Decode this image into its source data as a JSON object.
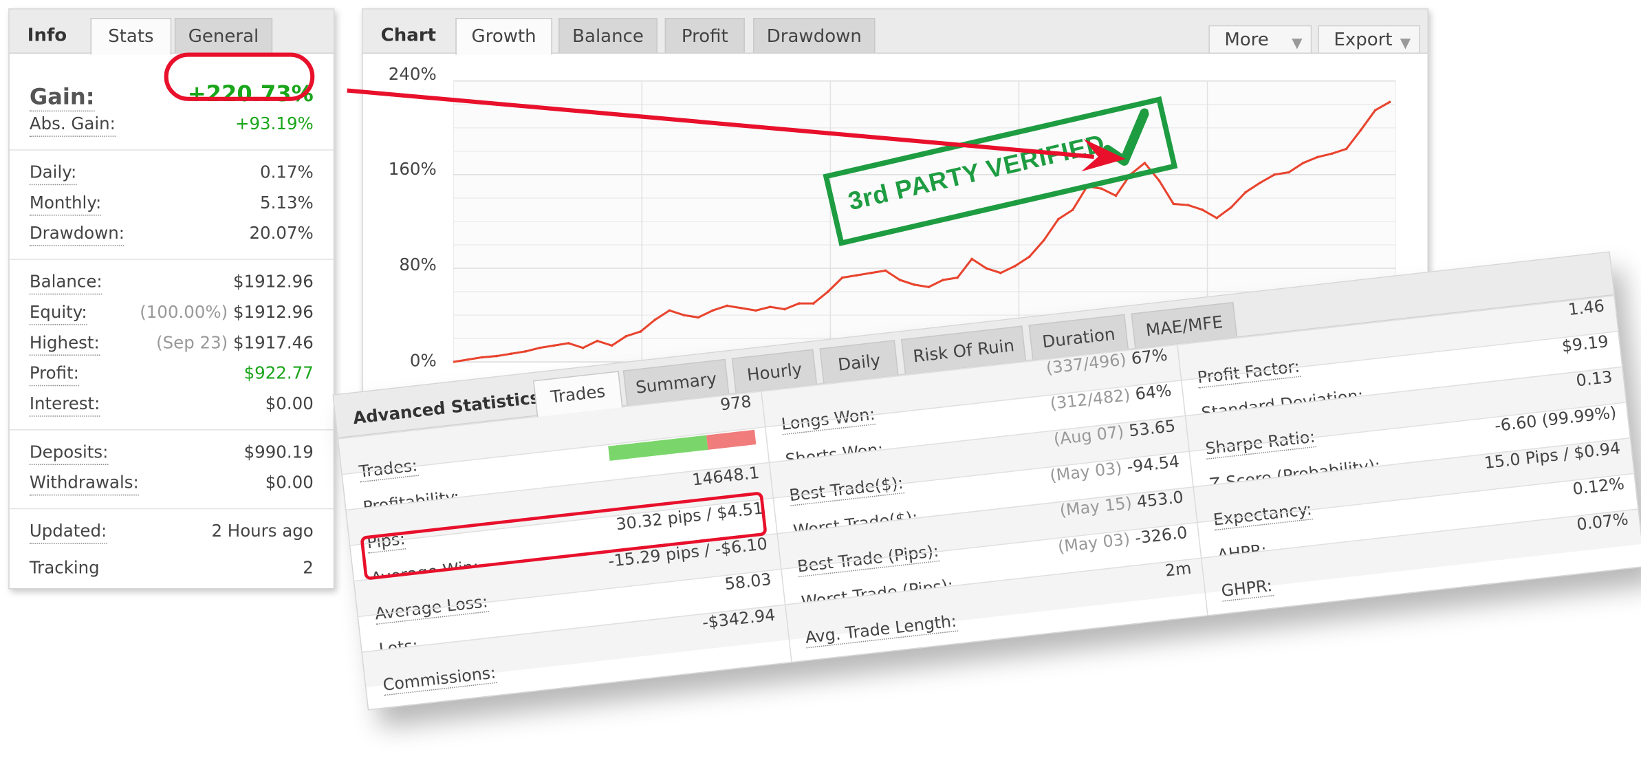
{
  "info_panel": {
    "tabs": [
      {
        "label": "Info"
      },
      {
        "label": "Stats"
      },
      {
        "label": "General"
      }
    ],
    "gain": {
      "label": "Gain:",
      "value": "+220.73%"
    },
    "groups": [
      [
        {
          "label": "Abs. Gain:",
          "value": "+93.19%",
          "green": true
        }
      ],
      [
        {
          "label": "Daily:",
          "value": "0.17%"
        },
        {
          "label": "Monthly:",
          "value": "5.13%"
        },
        {
          "label": "Drawdown:",
          "value": "20.07%"
        }
      ],
      [
        {
          "label": "Balance:",
          "value": "$1912.96"
        },
        {
          "label": "Equity:",
          "note": "(100.00%)",
          "value": "$1912.96"
        },
        {
          "label": "Highest:",
          "note": "(Sep 23)",
          "value": "$1917.46"
        },
        {
          "label": "Profit:",
          "value": "$922.77",
          "green": true
        },
        {
          "label": "Interest:",
          "value": "$0.00"
        }
      ],
      [
        {
          "label": "Deposits:",
          "value": "$990.19"
        },
        {
          "label": "Withdrawals:",
          "value": "$0.00"
        }
      ],
      [
        {
          "label": "Updated:",
          "value": "2 Hours ago"
        },
        {
          "label": "Tracking",
          "value": "2",
          "plain": true
        }
      ]
    ]
  },
  "chart_panel": {
    "tabs": [
      {
        "label": "Chart"
      },
      {
        "label": "Growth"
      },
      {
        "label": "Balance"
      },
      {
        "label": "Profit"
      },
      {
        "label": "Drawdown"
      }
    ],
    "more_label": "More",
    "export_label": "Export",
    "stamp_text": "3rd PARTY VERIFIED"
  },
  "chart_data": {
    "type": "line",
    "title": "",
    "xlabel": "",
    "ylabel": "",
    "y_ticks": [
      "240%",
      "160%",
      "80%",
      "0%"
    ],
    "ylim": [
      0,
      240
    ],
    "grid": true,
    "color": "#e8442e",
    "series": [
      {
        "values": [
          0,
          2,
          4,
          5,
          7,
          9,
          12,
          14,
          16,
          12,
          18,
          14,
          22,
          26,
          36,
          44,
          40,
          38,
          44,
          48,
          46,
          44,
          47,
          45,
          50,
          50,
          60,
          72,
          74,
          76,
          78,
          70,
          66,
          64,
          70,
          72,
          88,
          80,
          76,
          82,
          90,
          104,
          122,
          130,
          150,
          148,
          142,
          160,
          170,
          155,
          135,
          134,
          130,
          123,
          132,
          145,
          153,
          160,
          162,
          170,
          175,
          178,
          182,
          198,
          215,
          222
        ]
      }
    ]
  },
  "advanced": {
    "title": "Advanced Statistics",
    "tabs": [
      {
        "label": "Trades"
      },
      {
        "label": "Summary"
      },
      {
        "label": "Hourly"
      },
      {
        "label": "Daily"
      },
      {
        "label": "Risk Of Ruin"
      },
      {
        "label": "Duration"
      },
      {
        "label": "MAE/MFE"
      }
    ],
    "col1": [
      {
        "label": "Trades:",
        "value": "978"
      },
      {
        "label": "Profitability:",
        "value": "",
        "bar": true
      },
      {
        "label": "Pips:",
        "value": "14648.1"
      },
      {
        "label": "Average Win:",
        "value": "30.32 pips / $4.51"
      },
      {
        "label": "Average Loss:",
        "value": "-15.29 pips / -$6.10"
      },
      {
        "label": "Lots:",
        "value": "58.03"
      },
      {
        "label": "Commissions:",
        "value": "-$342.94"
      }
    ],
    "profitability": {
      "win_fraction": 0.67
    },
    "col2": [
      {
        "label": "Longs Won:",
        "note": "(337/496)",
        "value": "67%"
      },
      {
        "label": "Shorts Won:",
        "note": "(312/482)",
        "value": "64%"
      },
      {
        "label": "Best Trade($):",
        "note": "(Aug 07)",
        "value": "53.65"
      },
      {
        "label": "Worst Trade($):",
        "note": "(May 03)",
        "value": "-94.54"
      },
      {
        "label": "Best Trade (Pips):",
        "note": "(May 15)",
        "value": "453.0"
      },
      {
        "label": "Worst Trade (Pips):",
        "note": "(May 03)",
        "value": "-326.0"
      },
      {
        "label": "Avg. Trade Length:",
        "value": "2m"
      }
    ],
    "col3": [
      {
        "label": "Profit Factor:",
        "value": "1.46"
      },
      {
        "label": "Standard Deviation:",
        "value": "$9.19"
      },
      {
        "label": "Sharpe Ratio:",
        "value": "0.13"
      },
      {
        "label": "Z-Score (Probability):",
        "value": "-6.60 (99.99%)"
      },
      {
        "label": "Expectancy:",
        "value": "15.0 Pips / $0.94"
      },
      {
        "label": "AHPR:",
        "value": "0.12%"
      },
      {
        "label": "GHPR:",
        "value": "0.07%"
      }
    ]
  }
}
